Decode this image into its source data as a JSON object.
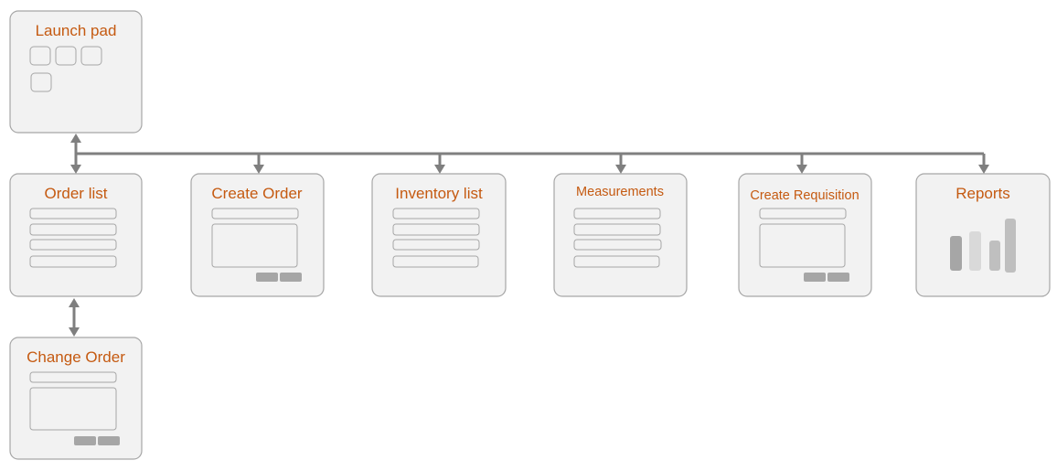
{
  "diagram": {
    "colors": {
      "title": "#c55a11",
      "box_fill": "#f2f2f2",
      "box_border": "#a6a6a6",
      "connector": "#7f7f7f"
    },
    "nodes": {
      "launch_pad": {
        "title": "Launch pad",
        "kind": "tiles"
      },
      "order_list": {
        "title": "Order list",
        "kind": "list"
      },
      "create_order": {
        "title": "Create Order",
        "kind": "form"
      },
      "inventory_list": {
        "title": "Inventory list",
        "kind": "list"
      },
      "measurements": {
        "title": "Measurements",
        "kind": "list"
      },
      "create_requisition": {
        "title": "Create Requisition",
        "kind": "form"
      },
      "reports": {
        "title": "Reports",
        "kind": "chart"
      },
      "change_order": {
        "title": "Change Order",
        "kind": "form"
      }
    },
    "edges": [
      {
        "from": "launch_pad",
        "to": "order_list",
        "bidirectional": true
      },
      {
        "from": "launch_pad",
        "to": "create_order"
      },
      {
        "from": "launch_pad",
        "to": "inventory_list"
      },
      {
        "from": "launch_pad",
        "to": "measurements"
      },
      {
        "from": "launch_pad",
        "to": "create_requisition"
      },
      {
        "from": "launch_pad",
        "to": "reports"
      },
      {
        "from": "order_list",
        "to": "change_order",
        "bidirectional": true
      }
    ]
  }
}
